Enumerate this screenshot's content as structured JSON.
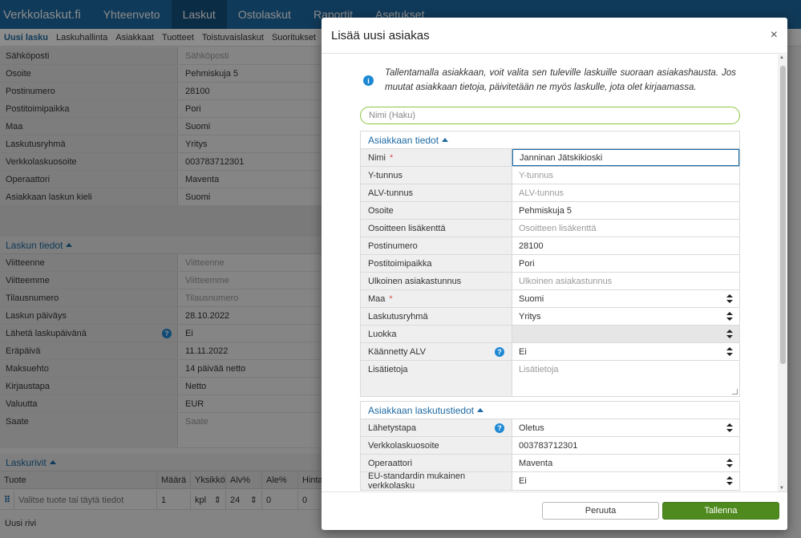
{
  "app": {
    "brand": "Verkkolaskut.fi",
    "nav": [
      "Yhteenveto",
      "Laskut",
      "Ostolaskut",
      "Raportit",
      "Asetukset"
    ],
    "nav_active": "Laskut",
    "subnav": [
      "Uusi lasku",
      "Laskuhallinta",
      "Asiakkaat",
      "Tuotteet",
      "Toistuvaislaskut",
      "Suoritukset"
    ]
  },
  "background": {
    "customer_rows": [
      {
        "label": "Sähköposti",
        "value": "Sähköposti",
        "placeholder": true
      },
      {
        "label": "Osoite",
        "value": "Pehmiskuja 5"
      },
      {
        "label": "Postinumero",
        "value": "28100"
      },
      {
        "label": "Postitoimipaikka",
        "value": "Pori"
      },
      {
        "label": "Maa",
        "value": "Suomi"
      },
      {
        "label": "Laskutusryhmä",
        "value": "Yritys"
      },
      {
        "label": "Verkkolaskuosoite",
        "value": "003783712301"
      },
      {
        "label": "Operaattori",
        "value": "Maventa"
      },
      {
        "label": "Asiakkaan laskun kieli",
        "value": "Suomi"
      }
    ],
    "invoice_section_title": "Laskun tiedot",
    "invoice_rows": [
      {
        "label": "Viitteenne",
        "value": "Viitteenne",
        "placeholder": true
      },
      {
        "label": "Viitteemme",
        "value": "Viitteemme",
        "placeholder": true
      },
      {
        "label": "Tilausnumero",
        "value": "Tilausnumero",
        "placeholder": true
      },
      {
        "label": "Laskun päiväys",
        "value": "28.10.2022"
      },
      {
        "label": "Lähetä laskupäivänä",
        "value": "Ei",
        "help": true
      },
      {
        "label": "Eräpäivä",
        "value": "11.11.2022"
      },
      {
        "label": "Maksuehto",
        "value": "14 päivää netto"
      },
      {
        "label": "Kirjaustapa",
        "value": "Netto"
      },
      {
        "label": "Valuutta",
        "value": "EUR"
      },
      {
        "label": "Saate",
        "value": "Saate",
        "placeholder": true
      }
    ],
    "rows_section_title": "Laskurivit",
    "rows_columns": [
      "Tuote",
      "Määrä",
      "Yksikkö",
      "Alv%",
      "Ale%",
      "Hinta"
    ],
    "rows_line": {
      "product_placeholder": "Valitse tuote tai täytä tiedot",
      "qty": "1",
      "unit": "kpl",
      "vat": "24",
      "discount": "0",
      "price": "0"
    },
    "new_row": "Uusi rivi"
  },
  "modal": {
    "title": "Lisää uusi asiakas",
    "close_symbol": "×",
    "info_text": "Tallentamalla asiakkaan, voit valita sen tuleville laskuille suoraan asiakashausta. Jos muutat asiakkaan tietoja, päivitetään ne myös laskulle, jota olet kirjaamassa.",
    "search_placeholder": "Nimi (Haku)",
    "customer_section_title": "Asiakkaan tiedot",
    "fields": {
      "name": {
        "label": "Nimi",
        "value": "Janninan Jätskikioski"
      },
      "business_id": {
        "label": "Y-tunnus",
        "placeholder": "Y-tunnus"
      },
      "vat_id": {
        "label": "ALV-tunnus",
        "placeholder": "ALV-tunnus"
      },
      "address": {
        "label": "Osoite",
        "value": "Pehmiskuja 5"
      },
      "address_extra": {
        "label": "Osoitteen lisäkenttä",
        "placeholder": "Osoitteen lisäkenttä"
      },
      "postal_code": {
        "label": "Postinumero",
        "value": "28100"
      },
      "city": {
        "label": "Postitoimipaikka",
        "value": "Pori"
      },
      "external_id": {
        "label": "Ulkoinen asiakastunnus",
        "placeholder": "Ulkoinen asiakastunnus"
      },
      "country": {
        "label": "Maa",
        "value": "Suomi"
      },
      "billing_group": {
        "label": "Laskutusryhmä",
        "value": "Yritys"
      },
      "category": {
        "label": "Luokka",
        "value": ""
      },
      "reverse_vat": {
        "label": "Käännetty ALV",
        "value": "Ei"
      },
      "notes": {
        "label": "Lisätietoja",
        "placeholder": "Lisätietoja"
      }
    },
    "required_mark": "*",
    "billing_section_title": "Asiakkaan laskutustiedot",
    "billing": {
      "delivery": {
        "label": "Lähetystapa",
        "value": "Oletus"
      },
      "einvoice_address": {
        "label": "Verkkolaskuosoite",
        "value": "003783712301"
      },
      "operator": {
        "label": "Operaattori",
        "value": "Maventa"
      },
      "eu_standard": {
        "label": "EU-standardin mukainen verkkolasku",
        "value": "Ei"
      }
    },
    "cancel_label": "Peruuta",
    "save_label": "Tallenna"
  }
}
